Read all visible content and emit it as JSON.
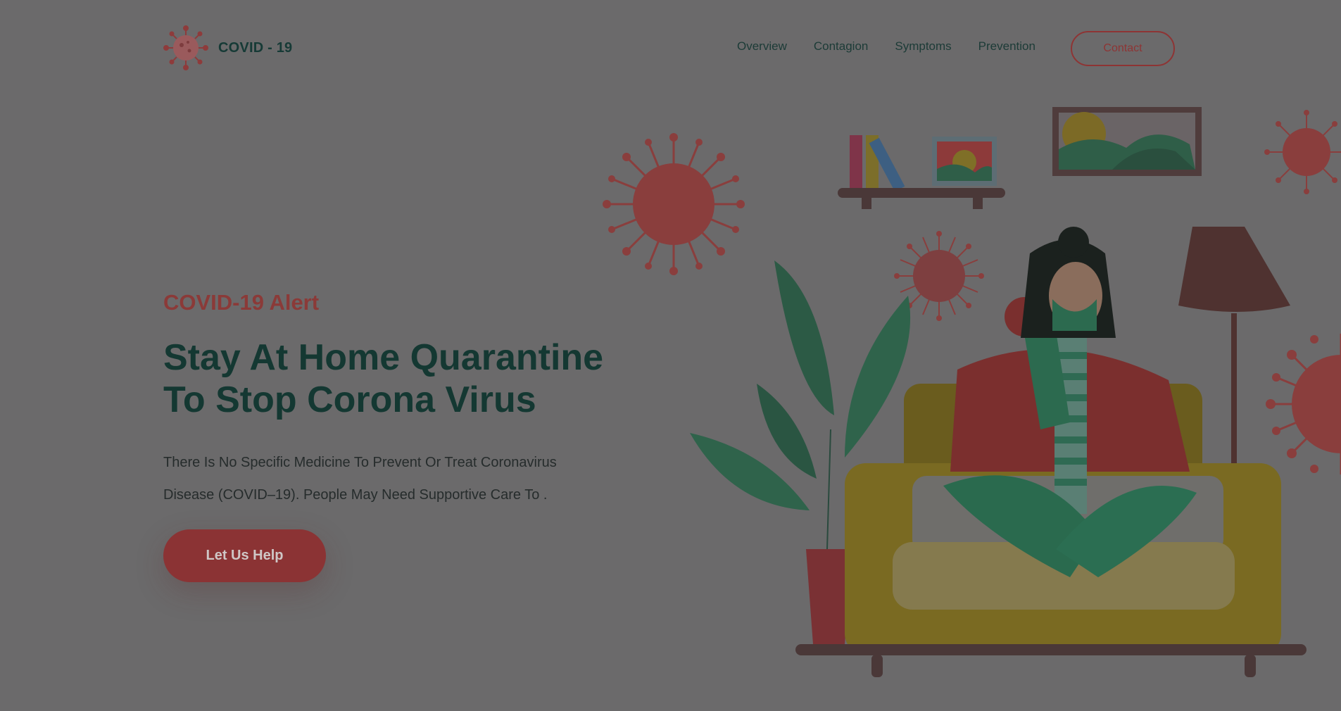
{
  "brand": {
    "name": "COVID - 19",
    "logo_icon": "virus-icon"
  },
  "nav": {
    "items": [
      {
        "label": "Overview"
      },
      {
        "label": "Contagion"
      },
      {
        "label": "Symptoms"
      },
      {
        "label": "Prevention"
      }
    ],
    "contact_label": "Contact"
  },
  "hero": {
    "alert": "COVID-19 Alert",
    "headline_line1": "Stay At Home Quarantine",
    "headline_line2": "To Stop Corona Virus",
    "desc_line1": "There Is No Specific Medicine To Prevent Or Treat Coronavirus",
    "desc_line2": "Disease (COVID–19). People May Need Supportive Care To .",
    "cta_label": "Let Us Help"
  },
  "colors": {
    "background": "#6b6a6b",
    "accent_red": "#8b3334",
    "dark_green": "#143832",
    "sofa_yellow": "#7a6a22"
  }
}
